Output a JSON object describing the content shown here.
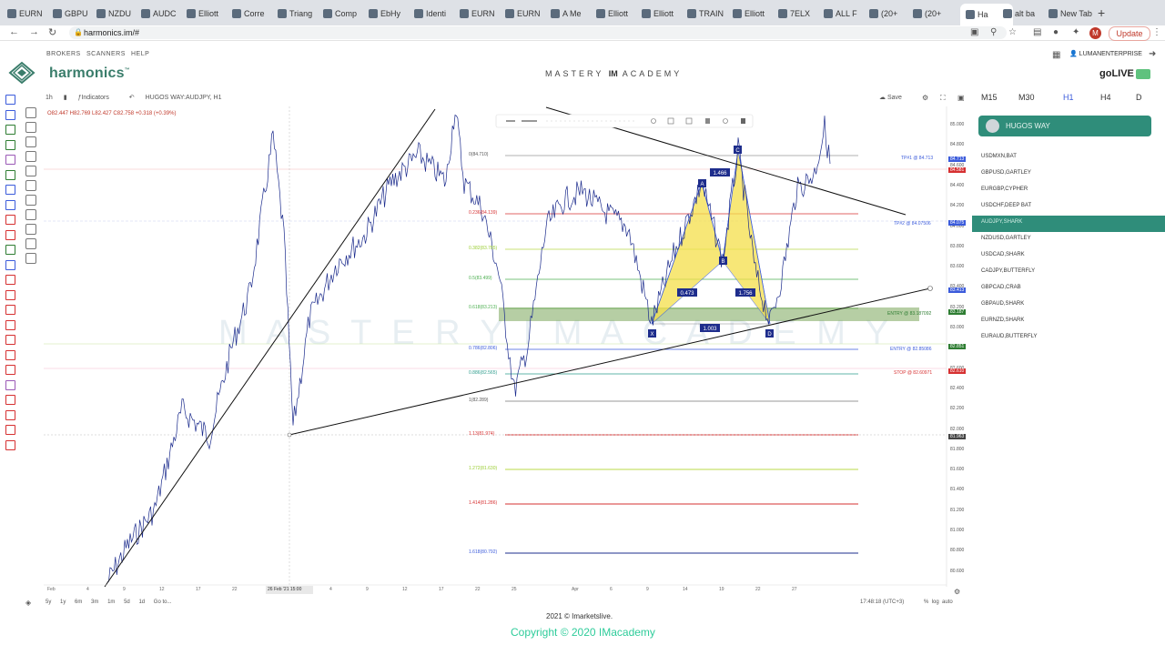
{
  "browser": {
    "tabs": [
      {
        "label": "EURN"
      },
      {
        "label": "GBPU"
      },
      {
        "label": "NZDU"
      },
      {
        "label": "AUDC"
      },
      {
        "label": "Elliott"
      },
      {
        "label": "Corre"
      },
      {
        "label": "Triang"
      },
      {
        "label": "Comp"
      },
      {
        "label": "EbHy"
      },
      {
        "label": "Identi"
      },
      {
        "label": "EURN"
      },
      {
        "label": "EURN"
      },
      {
        "label": "A Me"
      },
      {
        "label": "Elliott"
      },
      {
        "label": "Elliott"
      },
      {
        "label": "TRAIN"
      },
      {
        "label": "Elliott"
      },
      {
        "label": "7ELX"
      },
      {
        "label": "ALL F"
      },
      {
        "label": "(20+"
      },
      {
        "label": "(20+"
      },
      {
        "label": "Ha"
      },
      {
        "label": "alt ba"
      },
      {
        "label": "New Tab"
      }
    ],
    "active_tab_index": 21,
    "url": "harmonics.im/#",
    "profile_initial": "M",
    "update_label": "Update"
  },
  "site": {
    "brand": "harmonics",
    "brand_tm": "™",
    "nav": [
      "BROKERS",
      "SCANNERS",
      "HELP"
    ],
    "academy": "MASTERY",
    "academy_mark": "IM",
    "academy_tail": "ACADEMY",
    "user": "LUMANENTERPRISE",
    "go_live": "goLIVE"
  },
  "chart_toolbar": {
    "interval": "1h",
    "indicators_label": "Indicators",
    "symbol": "HUGOS WAY:AUDJPY, H1",
    "ohlc": "O82.447 H82.769 L82.427 C82.758 +0.318 (+0.39%)",
    "save_label": "Save"
  },
  "timeframes": [
    "M15",
    "M30",
    "H1",
    "H4",
    "D"
  ],
  "active_timeframe": "H1",
  "broker_button": "HUGOS WAY",
  "pairs": [
    "USDMXN,BAT",
    "GBPUSD,GARTLEY",
    "EURGBP,CYPHER",
    "USDCHF,DEEP BAT",
    "AUDJPY,SHARK",
    "NZDUSD,GARTLEY",
    "USDCAD,SHARK",
    "CADJPY,BUTTERFLY",
    "GBPCAD,CRAB",
    "GBPAUD,SHARK",
    "EURNZD,SHARK",
    "EURAUD,BUTTERFLY"
  ],
  "selected_pair": "AUDJPY,SHARK",
  "price_axis": [
    "85.000",
    "84.800",
    "84.600",
    "84.400",
    "84.200",
    "84.000",
    "83.800",
    "83.600",
    "83.400",
    "83.200",
    "83.000",
    "82.800",
    "82.600",
    "82.400",
    "82.200",
    "82.000",
    "81.800",
    "81.600",
    "81.400",
    "81.200",
    "81.000",
    "80.800",
    "80.600"
  ],
  "price_badges": [
    {
      "text": "84.713",
      "color": "#3b5bdb"
    },
    {
      "text": "84.581",
      "color": "#d63031"
    },
    {
      "text": "84.075",
      "color": "#3b5bdb"
    },
    {
      "text": "83.413",
      "color": "#3b5bdb"
    },
    {
      "text": "83.187",
      "color": "#2e7d32"
    },
    {
      "text": "82.851",
      "color": "#2e7d32"
    },
    {
      "text": "82.610",
      "color": "#d63031"
    },
    {
      "text": "81.963",
      "color": "#444"
    }
  ],
  "fib_labels": [
    {
      "text": "0(84.710)",
      "color": "#555"
    },
    {
      "text": "0.236(84.139)",
      "color": "#d63031"
    },
    {
      "text": "0.382(83.785)",
      "color": "#9acd32"
    },
    {
      "text": "0.5(83.499)",
      "color": "#4caf50"
    },
    {
      "text": "0.618(83.213)",
      "color": "#4caf50"
    },
    {
      "text": "0.786(82.806)",
      "color": "#3b5bdb"
    },
    {
      "text": "0.886(82.565)",
      "color": "#2e9d8d"
    },
    {
      "text": "1(82.289)",
      "color": "#555"
    },
    {
      "text": "1.13(81.974)",
      "color": "#d63031"
    },
    {
      "text": "1.272(81.630)",
      "color": "#9acd32"
    },
    {
      "text": "1.414(81.286)",
      "color": "#d63031"
    },
    {
      "text": "1.618(80.792)",
      "color": "#3b5bdb"
    }
  ],
  "trade_labels": [
    {
      "text": "TP#1 @ 84.713",
      "color": "#3b5bdb"
    },
    {
      "text": "TP#2 @ 84.07506",
      "color": "#3b5bdb"
    },
    {
      "text": "ENTRY @ 83.187092",
      "color": "#2e7d32"
    },
    {
      "text": "ENTRY @ 82.85086",
      "color": "#3b5bdb"
    },
    {
      "text": "STOP @ 82.60971",
      "color": "#d63031"
    }
  ],
  "pattern": {
    "points": [
      "X",
      "A",
      "B",
      "C",
      "D"
    ],
    "ratios": [
      "1.466",
      "0.473",
      "1.756",
      "1.003"
    ]
  },
  "dates": [
    "Feb",
    "4",
    "9",
    "12",
    "17",
    "22",
    "26 Feb '21  15:00",
    "4",
    "9",
    "12",
    "17",
    "22",
    "25",
    "Apr",
    "6",
    "9",
    "14",
    "19",
    "22",
    "27"
  ],
  "bottom": {
    "ranges": [
      "5y",
      "1y",
      "6m",
      "3m",
      "1m",
      "5d",
      "1d"
    ],
    "goto": "Go to...",
    "clock": "17:48:18 (UTC+3)",
    "pct": "%",
    "log": "log",
    "auto": "auto"
  },
  "source": "2021 © Imarketslive.",
  "copyright": "Copyright © 2020 IMacademy",
  "watermark": "M A S T E R Y   I M   A C A D E M Y"
}
